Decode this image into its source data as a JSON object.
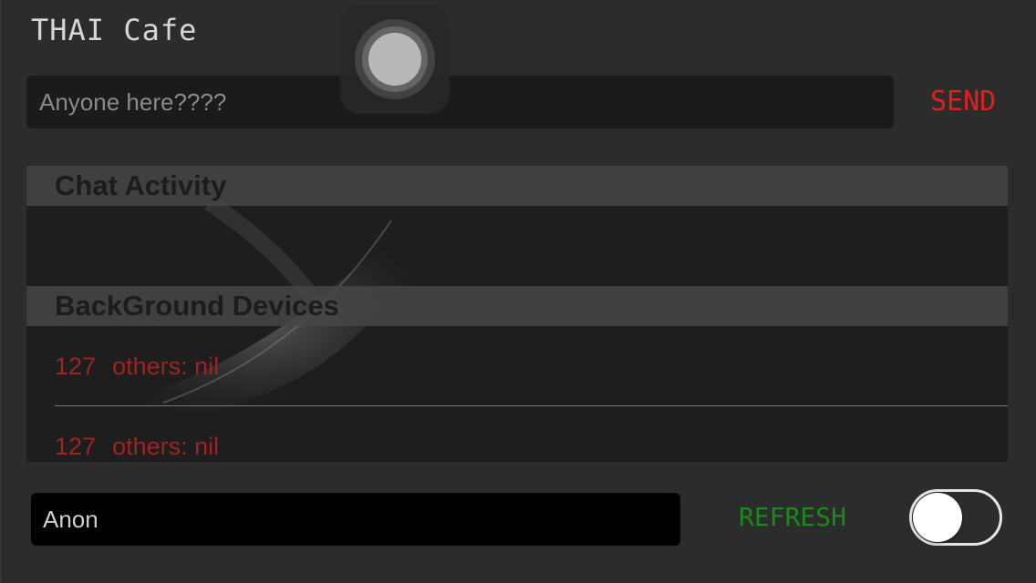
{
  "app": {
    "title": "THAI Cafe"
  },
  "composer": {
    "message_value": "Anyone here????",
    "send_label": "SEND"
  },
  "table": {
    "sections": [
      {
        "header": "Chat Activity",
        "rows": []
      },
      {
        "header": "BackGround Devices",
        "rows": [
          {
            "number": "127",
            "text": "others: nil"
          },
          {
            "number": "127",
            "text": "others: nil"
          }
        ]
      }
    ]
  },
  "footer": {
    "name_value": "Anon",
    "refresh_label": "REFRESH",
    "toggle_on": false
  },
  "colors": {
    "send": "#e0201a",
    "refresh": "#1a8a1a",
    "row_text": "#9c2424"
  },
  "icons": {
    "assistive_touch": "assistive-touch-icon"
  }
}
